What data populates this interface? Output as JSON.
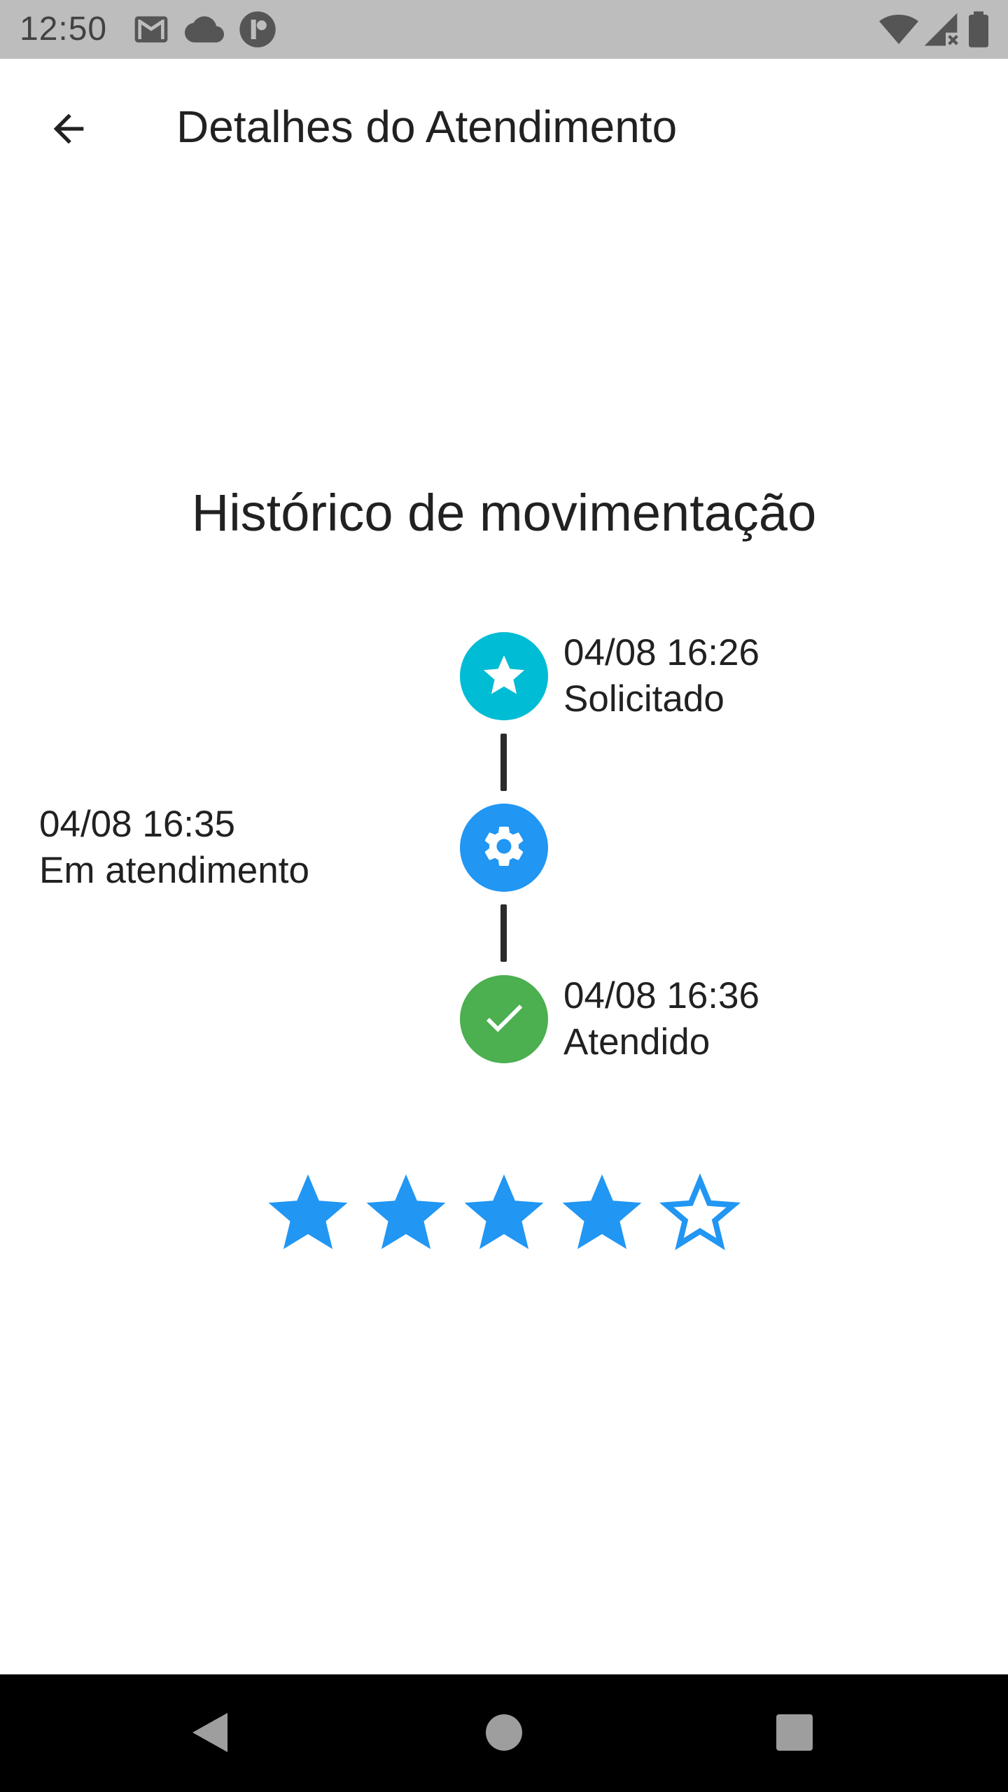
{
  "status_bar": {
    "time": "12:50",
    "icons": [
      "gmail-icon",
      "cloud-icon",
      "app-notification-icon",
      "wifi-icon",
      "cell-signal-icon",
      "battery-icon"
    ]
  },
  "app_bar": {
    "title": "Detalhes do Atendimento",
    "back_icon": "arrow-back-icon"
  },
  "history": {
    "title": "Histórico de movimentação",
    "events": [
      {
        "datetime": "04/08 16:26",
        "status": "Solicitado",
        "icon": "star-icon",
        "color": "#00bcd4",
        "side": "right"
      },
      {
        "datetime": "04/08 16:35",
        "status": "Em atendimento",
        "icon": "gear-icon",
        "color": "#2196f3",
        "side": "left"
      },
      {
        "datetime": "04/08 16:36",
        "status": "Atendido",
        "icon": "check-icon",
        "color": "#4caf50",
        "side": "right"
      }
    ]
  },
  "rating": {
    "value": 4,
    "max": 5,
    "color": "#2196f3"
  },
  "nav_bar": {
    "buttons": [
      "back-triangle-icon",
      "home-circle-icon",
      "recents-square-icon"
    ]
  }
}
